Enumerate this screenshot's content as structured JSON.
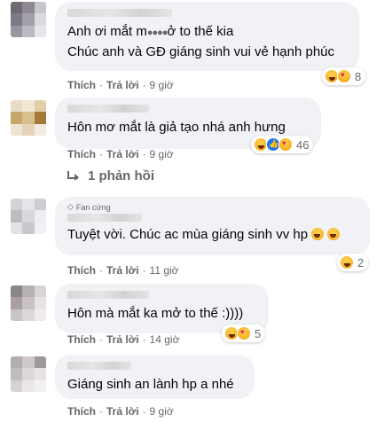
{
  "comments": [
    {
      "lines": [
        "Anh ơi mắt m",
        "ở to thế kia",
        "Chúc anh và GĐ giáng sinh vui vẻ hạnh phúc"
      ],
      "masked_glyphs": "●●●●",
      "like_label": "Thích",
      "reply_label": "Trả lời",
      "time": "9 giờ",
      "reaction_count": "8",
      "reactions": [
        "haha-icon",
        "love-icon"
      ]
    },
    {
      "text": "Hôn mơ mắt là giả tạo nhá anh hưng",
      "like_label": "Thích",
      "reply_label": "Trả lời",
      "time": "9 giờ",
      "reaction_count": "46",
      "reactions": [
        "haha-icon",
        "like-icon",
        "love-icon"
      ],
      "replies_label": "1 phản hồi"
    },
    {
      "badge": "Fan cứng",
      "text": "Tuyệt vời. Chúc ac mùa giáng sinh vv hp",
      "like_label": "Thích",
      "reply_label": "Trả lời",
      "time": "11 giờ",
      "reaction_count": "2",
      "reactions": [
        "haha-icon"
      ]
    },
    {
      "text": "Hôn mà mắt ka mở to thế :))))",
      "like_label": "Thích",
      "reply_label": "Trả lời",
      "time": "14 giờ",
      "reaction_count": "5",
      "reactions": [
        "haha-icon",
        "love-icon"
      ]
    },
    {
      "text": "Giáng sinh an lành hp a nhé",
      "like_label": "Thích",
      "reply_label": "Trả lời",
      "time": "9 giờ"
    }
  ],
  "separator": "·",
  "colors": {
    "bubble": "#f0f2f5",
    "meta": "#65676b",
    "text": "#050505"
  }
}
